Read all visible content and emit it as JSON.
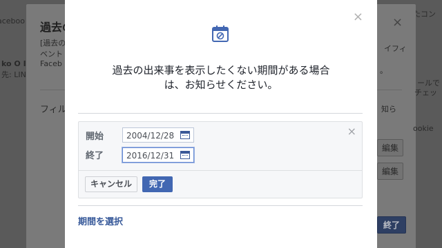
{
  "background": {
    "left_header": "aceboo",
    "right_header": "たコン",
    "dialog_title": "過去の",
    "texts": [
      "[過去の",
      "ベント",
      "Faceb",
      "ko O I",
      "先: LIN",
      "フィル",
      "イフィ",
      "。",
      "ールで",
      "チェッ",
      "知ら",
      "ookie"
    ],
    "edit_label": "編集",
    "finish_label": "終了"
  },
  "modal": {
    "close_symbol": "×",
    "icon": "calendar-blocked-icon",
    "message_lines": [
      "過去の出来事を表示したくない期間がある場合",
      "は、お知らせください。"
    ],
    "range": {
      "close_symbol": "×",
      "start_label": "開始",
      "start_value": "2004/12/28",
      "end_label": "終了",
      "end_value": "2016/12/31",
      "cancel_label": "キャンセル",
      "done_label": "完了"
    },
    "select_period_label": "期間を選択"
  },
  "colors": {
    "overlay": "#4b4b4b",
    "primary_blue": "#4267b2",
    "link_blue": "#365899"
  }
}
